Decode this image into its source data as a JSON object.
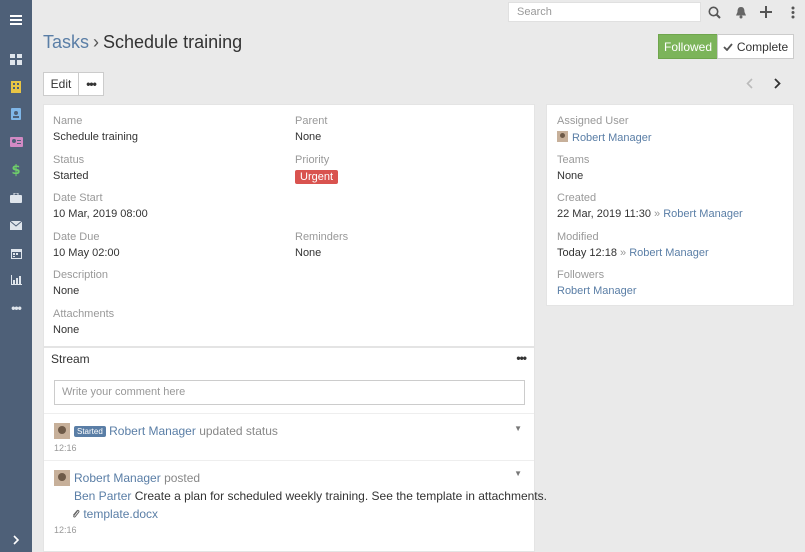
{
  "topbar": {
    "search_placeholder": "Search"
  },
  "header": {
    "scope": "Tasks",
    "separator": "›",
    "title": "Schedule training",
    "followed_label": "Followed",
    "complete_label": "Complete"
  },
  "actions": {
    "edit_label": "Edit",
    "more_label": "•••"
  },
  "detail": {
    "name_label": "Name",
    "name_value": "Schedule training",
    "parent_label": "Parent",
    "parent_value": "None",
    "status_label": "Status",
    "status_value": "Started",
    "priority_label": "Priority",
    "priority_value": "Urgent",
    "date_start_label": "Date Start",
    "date_start_value": "10 Mar, 2019 08:00",
    "date_due_label": "Date Due",
    "date_due_value": "10 May 02:00",
    "reminders_label": "Reminders",
    "reminders_value": "None",
    "description_label": "Description",
    "description_value": "None",
    "attachments_label": "Attachments",
    "attachments_value": "None"
  },
  "side": {
    "assigned_label": "Assigned User",
    "assigned_value": "Robert Manager",
    "teams_label": "Teams",
    "teams_value": "None",
    "created_label": "Created",
    "created_date": "22 Mar, 2019 11:30",
    "created_by": "Robert Manager",
    "modified_label": "Modified",
    "modified_date": "Today 12:18",
    "modified_by": "Robert Manager",
    "followers_label": "Followers",
    "followers_value": "Robert Manager",
    "arrow": "»"
  },
  "stream": {
    "title": "Stream",
    "more_label": "•••",
    "comment_placeholder": "Write your comment here",
    "notes": [
      {
        "badge": "Started",
        "user": "Robert Manager",
        "action": "updated status",
        "time": "12:16"
      },
      {
        "user": "Robert Manager",
        "action": "posted",
        "mention": "Ben Parter",
        "text": "Create a plan for scheduled weekly training. See the template in attachments.",
        "attachment": "template.docx",
        "time": "12:16"
      }
    ]
  },
  "colors": {
    "sidebar": "#4e6078",
    "link": "#5a7ea6",
    "followed": "#7cb45a",
    "urgent": "#d9534f"
  }
}
